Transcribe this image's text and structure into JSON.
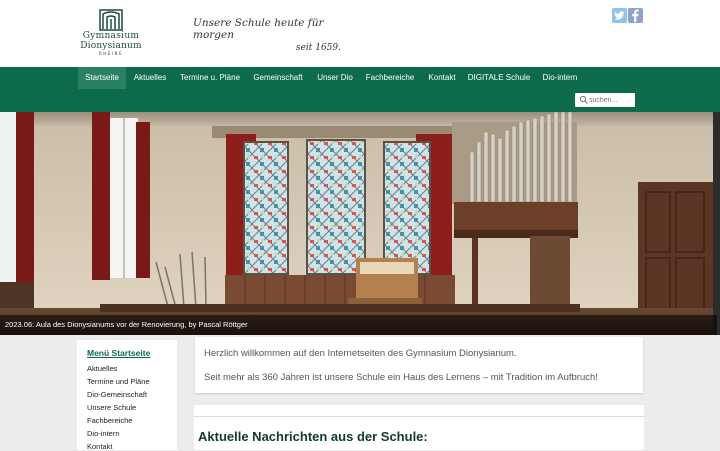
{
  "header": {
    "logo": {
      "line1": "Gymnasium",
      "line2": "Dionysianum",
      "line3": "RHEINE"
    },
    "slogan": {
      "line1": "Unsere Schule heute für morgen",
      "line2": "seit 1659."
    },
    "social": [
      {
        "name": "twitter-icon"
      },
      {
        "name": "facebook-icon"
      }
    ]
  },
  "nav": {
    "items": [
      {
        "label": "Startseite",
        "active": true
      },
      {
        "label": "Aktuelles"
      },
      {
        "label": "Termine u. Pläne"
      },
      {
        "label": "Gemeinschaft"
      },
      {
        "label": "Unser Dio"
      },
      {
        "label": "Fachbereiche"
      },
      {
        "label": "Kontakt"
      },
      {
        "label": "DIGITALE Schule"
      },
      {
        "label": "Dio-intern"
      }
    ],
    "search_placeholder": "suchen..."
  },
  "hero": {
    "caption": "2023.06: Aula des Dionysianums vor der Renovierung, by Pascal Röttger"
  },
  "sidebar": {
    "title": "Menü Startseite",
    "items": [
      "Aktuelles",
      "Termine und Pläne",
      "Dio-Gemeinschaft",
      "Unsere Schule",
      "Fachbereiche",
      "Dio-intern",
      "Kontakt"
    ]
  },
  "main": {
    "welcome_line1": "Herzlich willkommen auf den Internetseiten des Gymnasium Dionysianum.",
    "welcome_line2": "Seit mehr als 360 Jahren ist unsere Schule ein Haus des Lernens – mit Tradition im Aufbruch!",
    "news_heading": "Aktuelle Nachrichten aus der Schule:"
  },
  "colors": {
    "nav_bg": "#0d6b4c",
    "nav_active": "#2a8064",
    "accent": "#0d6b4c"
  }
}
